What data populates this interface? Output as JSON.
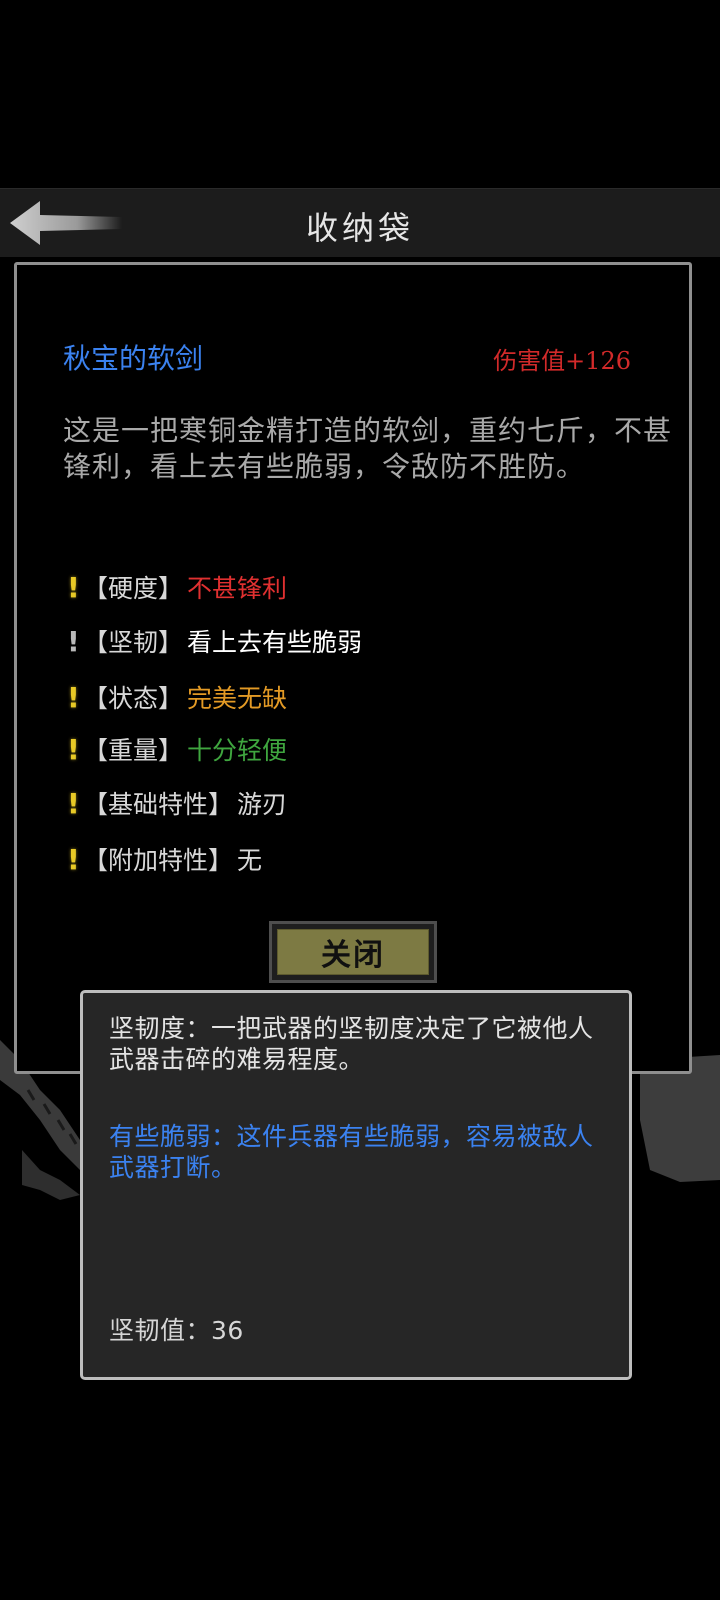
{
  "header": {
    "title": "收纳袋",
    "back_icon": "back-arrow-icon"
  },
  "item": {
    "name": "秋宝的软剑",
    "damage": "伤害值+126",
    "description": "这是一把寒铜金精打造的软剑，重约七斤，不甚锋利，看上去有些脆弱，令敌防不胜防。",
    "attributes": [
      {
        "icon": "!",
        "label": "【硬度】",
        "value": "不甚锋利",
        "color": "#e03030"
      },
      {
        "icon": "!",
        "label": "【坚韧】",
        "value": "看上去有些脆弱",
        "color": "#ffffff"
      },
      {
        "icon": "!",
        "label": "【状态】",
        "value": "完美无缺",
        "color": "#e39a25"
      },
      {
        "icon": "!",
        "label": "【重量】",
        "value": "十分轻便",
        "color": "#3fa63f"
      },
      {
        "icon": "!",
        "label": "【基础特性】",
        "value": "游刃",
        "color": "#d8d8d8"
      },
      {
        "icon": "!",
        "label": "【附加特性】",
        "value": "无",
        "color": "#d8d8d8"
      }
    ],
    "close_label": "关闭"
  },
  "tooltip": {
    "definition": "坚韧度：一把武器的坚韧度决定了它被他人武器击碎的难易程度。",
    "level_desc": "有些脆弱：这件兵器有些脆弱，容易被敌人武器打断。",
    "value_text": "坚韧值：36"
  },
  "colors": {
    "accent_blue": "#3b82f0",
    "damage_red": "#d22a2a",
    "button_olive": "#7d7a43"
  }
}
